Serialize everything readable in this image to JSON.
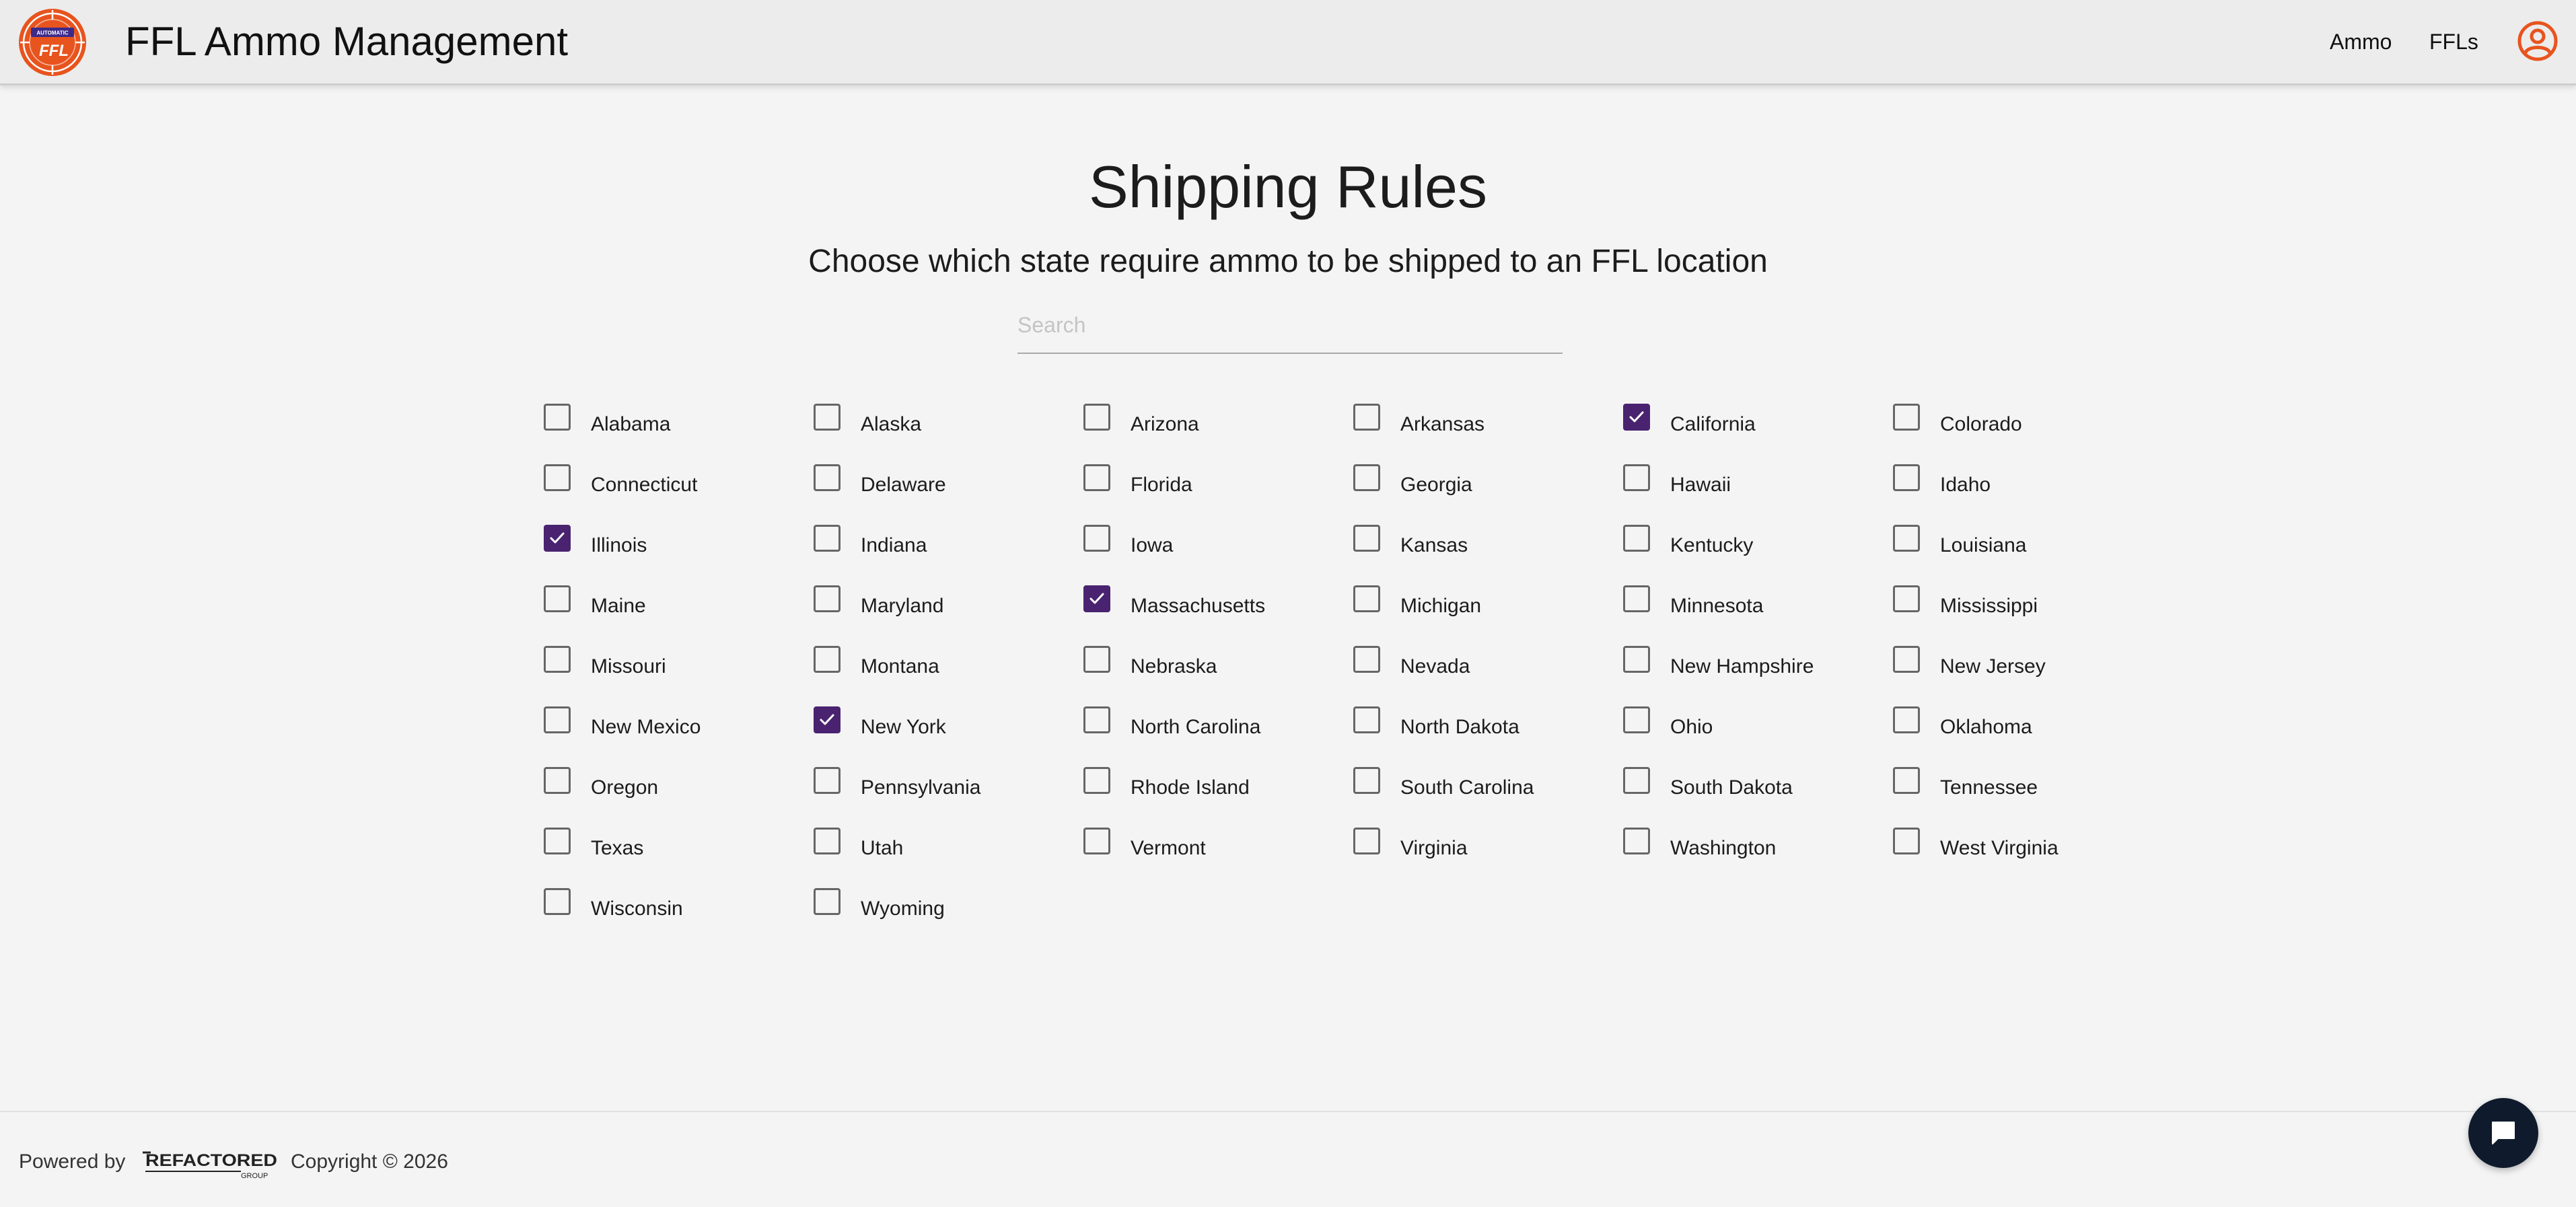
{
  "header": {
    "app_title": "FFL Ammo Management",
    "logo_text_top": "AUTOMATIC",
    "logo_text_main": "FFL",
    "nav": [
      {
        "label": "Ammo"
      },
      {
        "label": "FFLs"
      }
    ],
    "profile_icon": "account-circle-icon"
  },
  "main": {
    "title": "Shipping Rules",
    "subtitle": "Choose which state require ammo to be shipped to an FFL location",
    "search": {
      "placeholder": "Search",
      "value": ""
    },
    "states": [
      {
        "name": "Alabama",
        "checked": false
      },
      {
        "name": "Alaska",
        "checked": false
      },
      {
        "name": "Arizona",
        "checked": false
      },
      {
        "name": "Arkansas",
        "checked": false
      },
      {
        "name": "California",
        "checked": true
      },
      {
        "name": "Colorado",
        "checked": false
      },
      {
        "name": "Connecticut",
        "checked": false
      },
      {
        "name": "Delaware",
        "checked": false
      },
      {
        "name": "Florida",
        "checked": false
      },
      {
        "name": "Georgia",
        "checked": false
      },
      {
        "name": "Hawaii",
        "checked": false
      },
      {
        "name": "Idaho",
        "checked": false
      },
      {
        "name": "Illinois",
        "checked": true
      },
      {
        "name": "Indiana",
        "checked": false
      },
      {
        "name": "Iowa",
        "checked": false
      },
      {
        "name": "Kansas",
        "checked": false
      },
      {
        "name": "Kentucky",
        "checked": false
      },
      {
        "name": "Louisiana",
        "checked": false
      },
      {
        "name": "Maine",
        "checked": false
      },
      {
        "name": "Maryland",
        "checked": false
      },
      {
        "name": "Massachusetts",
        "checked": true
      },
      {
        "name": "Michigan",
        "checked": false
      },
      {
        "name": "Minnesota",
        "checked": false
      },
      {
        "name": "Mississippi",
        "checked": false
      },
      {
        "name": "Missouri",
        "checked": false
      },
      {
        "name": "Montana",
        "checked": false
      },
      {
        "name": "Nebraska",
        "checked": false
      },
      {
        "name": "Nevada",
        "checked": false
      },
      {
        "name": "New Hampshire",
        "checked": false
      },
      {
        "name": "New Jersey",
        "checked": false
      },
      {
        "name": "New Mexico",
        "checked": false
      },
      {
        "name": "New York",
        "checked": true
      },
      {
        "name": "North Carolina",
        "checked": false
      },
      {
        "name": "North Dakota",
        "checked": false
      },
      {
        "name": "Ohio",
        "checked": false
      },
      {
        "name": "Oklahoma",
        "checked": false
      },
      {
        "name": "Oregon",
        "checked": false
      },
      {
        "name": "Pennsylvania",
        "checked": false
      },
      {
        "name": "Rhode Island",
        "checked": false
      },
      {
        "name": "South Carolina",
        "checked": false
      },
      {
        "name": "South Dakota",
        "checked": false
      },
      {
        "name": "Tennessee",
        "checked": false
      },
      {
        "name": "Texas",
        "checked": false
      },
      {
        "name": "Utah",
        "checked": false
      },
      {
        "name": "Vermont",
        "checked": false
      },
      {
        "name": "Virginia",
        "checked": false
      },
      {
        "name": "Washington",
        "checked": false
      },
      {
        "name": "West Virginia",
        "checked": false
      },
      {
        "name": "Wisconsin",
        "checked": false
      },
      {
        "name": "Wyoming",
        "checked": false
      }
    ]
  },
  "footer": {
    "powered_by": "Powered by",
    "brand_name": "REFACTORED",
    "brand_sub": "GROUP",
    "copyright": "Copyright © 2026",
    "chat_icon": "chat-bubble-icon"
  },
  "colors": {
    "accent_checkbox": "#4a2370",
    "brand_orange": "#e8541e",
    "chat_button": "#0f1b2d",
    "background": "#f4f4f4",
    "appbar": "#ececec"
  }
}
